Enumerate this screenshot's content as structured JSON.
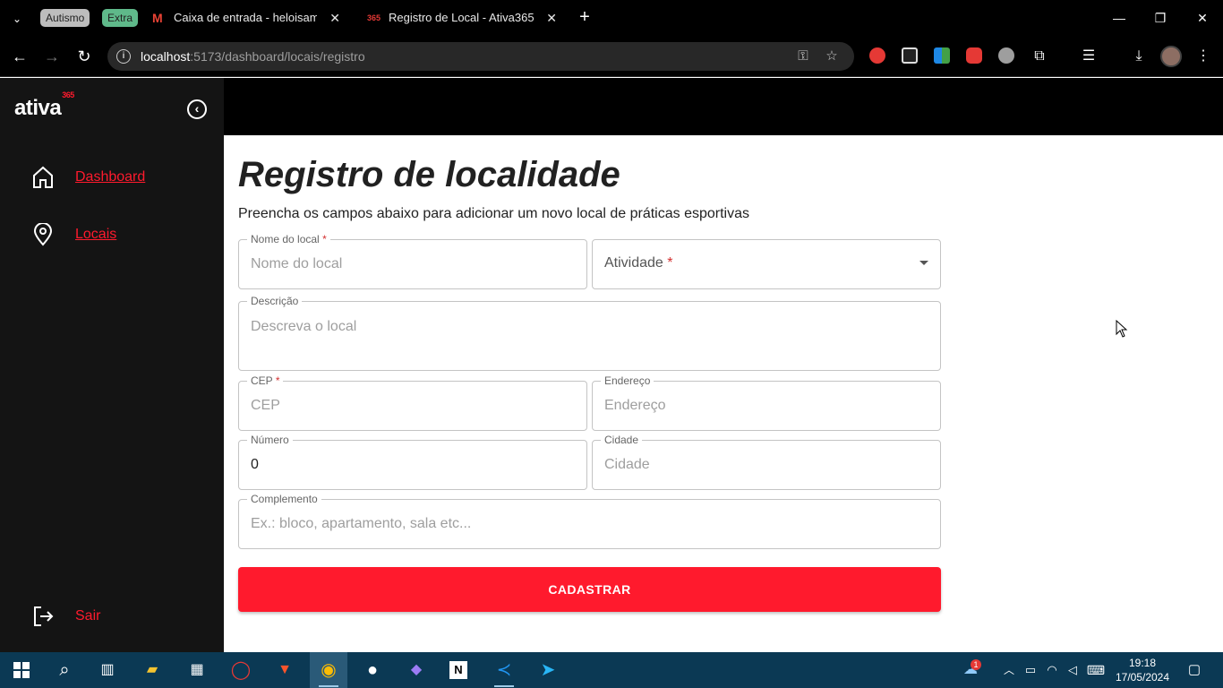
{
  "browser": {
    "tab_groups": [
      "Autismo",
      "Extra"
    ],
    "tabs": [
      {
        "title": "Caixa de entrada - heloisamt@g",
        "favicon": "gmail-icon"
      },
      {
        "title": "Registro de Local - Ativa365",
        "favicon": "ativa365-icon",
        "favicon_text": "365"
      }
    ],
    "url_host": "localhost",
    "url_rest": ":5173/dashboard/locais/registro"
  },
  "app": {
    "logo": "ativa",
    "logo_sup": "365",
    "nav": [
      {
        "label": "Dashboard",
        "icon": "home-icon"
      },
      {
        "label": "Locais",
        "icon": "location-pin-icon"
      }
    ],
    "logout_label": "Sair",
    "accent_color": "#ff1a2d"
  },
  "page": {
    "title": "Registro de localidade",
    "subtitle": "Preencha os campos abaixo para adicionar um novo local de práticas esportivas"
  },
  "form": {
    "nome": {
      "label": "Nome do local",
      "required_mark": "*",
      "placeholder": "Nome do local",
      "value": ""
    },
    "atividade": {
      "label": "Atividade",
      "required_mark": "*"
    },
    "descricao": {
      "label": "Descrição",
      "placeholder": "Descreva o local",
      "value": ""
    },
    "cep": {
      "label": "CEP",
      "required_mark": "*",
      "placeholder": "CEP",
      "value": ""
    },
    "endereco": {
      "label": "Endereço",
      "placeholder": "Endereço",
      "value": ""
    },
    "numero": {
      "label": "Número",
      "value": "0"
    },
    "cidade": {
      "label": "Cidade",
      "placeholder": "Cidade",
      "value": ""
    },
    "complemento": {
      "label": "Complemento",
      "placeholder": "Ex.: bloco, apartamento, sala etc...",
      "value": ""
    },
    "submit_label": "CADASTRAR"
  },
  "taskbar": {
    "time": "19:18",
    "date": "17/05/2024",
    "notification_count": "1"
  }
}
